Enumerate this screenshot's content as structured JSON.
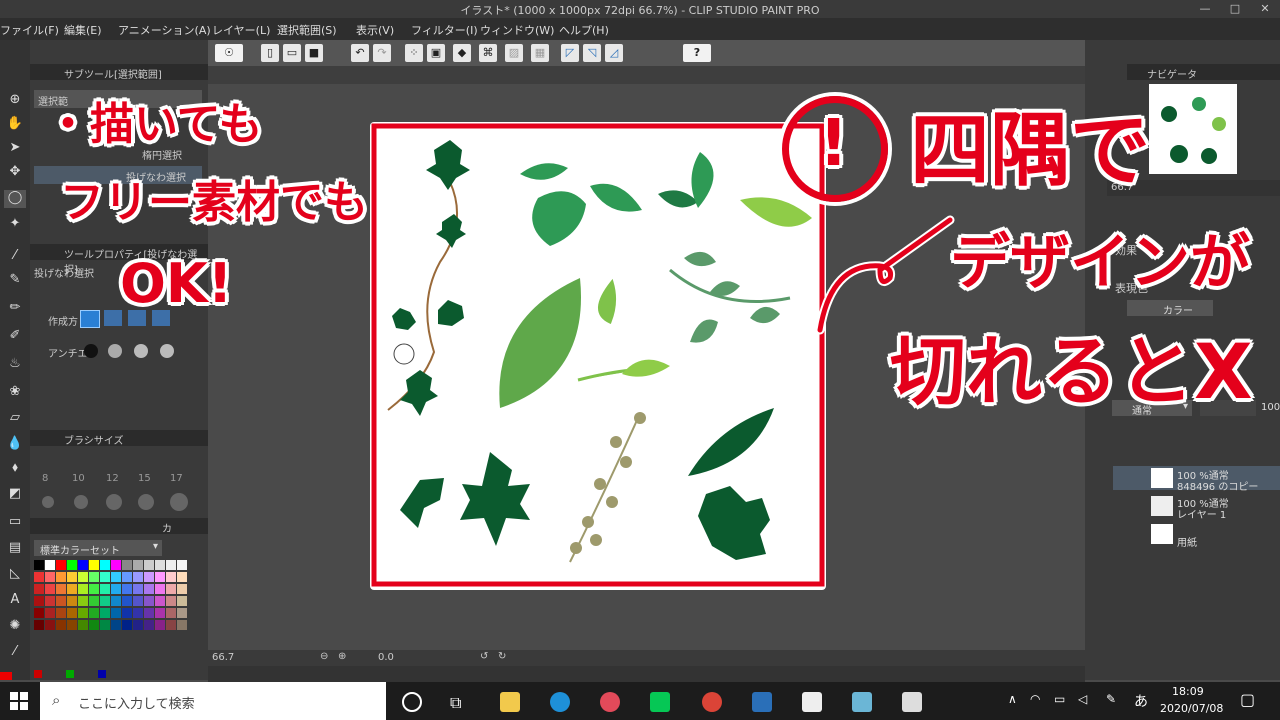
{
  "window": {
    "title": "イラスト* (1000 x 1000px 72dpi 66.7%) - CLIP STUDIO PAINT PRO",
    "minimize": "—",
    "maximize": "□",
    "close": "✕"
  },
  "menu": [
    "ファイル(F)",
    "編集(E)",
    "アニメーション(A)",
    "レイヤー(L)",
    "選択範囲(S)",
    "表示(V)",
    "フィルター(I)",
    "ウィンドウ(W)",
    "ヘルプ(H)"
  ],
  "left_panel": {
    "subtool_header": "サブツール[選択範囲]",
    "subtool_items": [
      "選択範",
      "楕円選択",
      "投げなわ選択"
    ],
    "toolprop_header": "ツールプロパティ[投げなわ選択]",
    "toolprop_name": "投げなわ選択",
    "mode_label": "作成方",
    "antialias_label": "アンチエ",
    "brushsize_header": "ブラシサイズ",
    "brush_sizes": [
      "8",
      "10",
      "12",
      "15",
      "17"
    ],
    "colorset_header": "カ",
    "colorset_name": "標準カラーセット"
  },
  "canvas_status": {
    "zoom": "66.7",
    "angle": "0.0"
  },
  "right_panel": {
    "navigator_header": "ナビゲータ",
    "nav_zoom": "66.7",
    "effect_label": "効果",
    "expression_label": "表現色",
    "expression_value": "カラー",
    "blend_mode": "通常",
    "opacity": "100",
    "layers": [
      {
        "line1": "100 %通常",
        "line2": "848496 のコピー"
      },
      {
        "line1": "100 %通常",
        "line2": "レイヤー 1"
      },
      {
        "line1": "",
        "line2": "用紙"
      }
    ]
  },
  "taskbar": {
    "search_placeholder": "ここに入力して検索",
    "time": "18:09",
    "date": "2020/07/08",
    "ime": "あ"
  },
  "overlay": {
    "left_line1": "・描いても",
    "left_line2": "フリー素材でも",
    "left_line3": "OK!",
    "number": "!",
    "right_line1": "四隅で",
    "right_line2": "デザインが",
    "right_line3": "切れるとX"
  },
  "colors": {
    "red": "#e4001b",
    "leaf_dark": "#0b5a2e",
    "leaf_mid": "#2e9a55",
    "leaf_light": "#7fc24a",
    "stem": "#9a6a3a",
    "olive": "#9e9a6c"
  },
  "icons": [
    "windows-logo-icon",
    "search-icon",
    "cortana-icon",
    "task-view-icon",
    "folder-icon",
    "edge-icon",
    "app-icon",
    "line-icon",
    "chrome-icon",
    "photos-icon",
    "clip-studio-icon",
    "clip-studio-paint-icon",
    "network-icon",
    "battery-icon",
    "volume-icon",
    "pen-icon",
    "notification-icon"
  ]
}
